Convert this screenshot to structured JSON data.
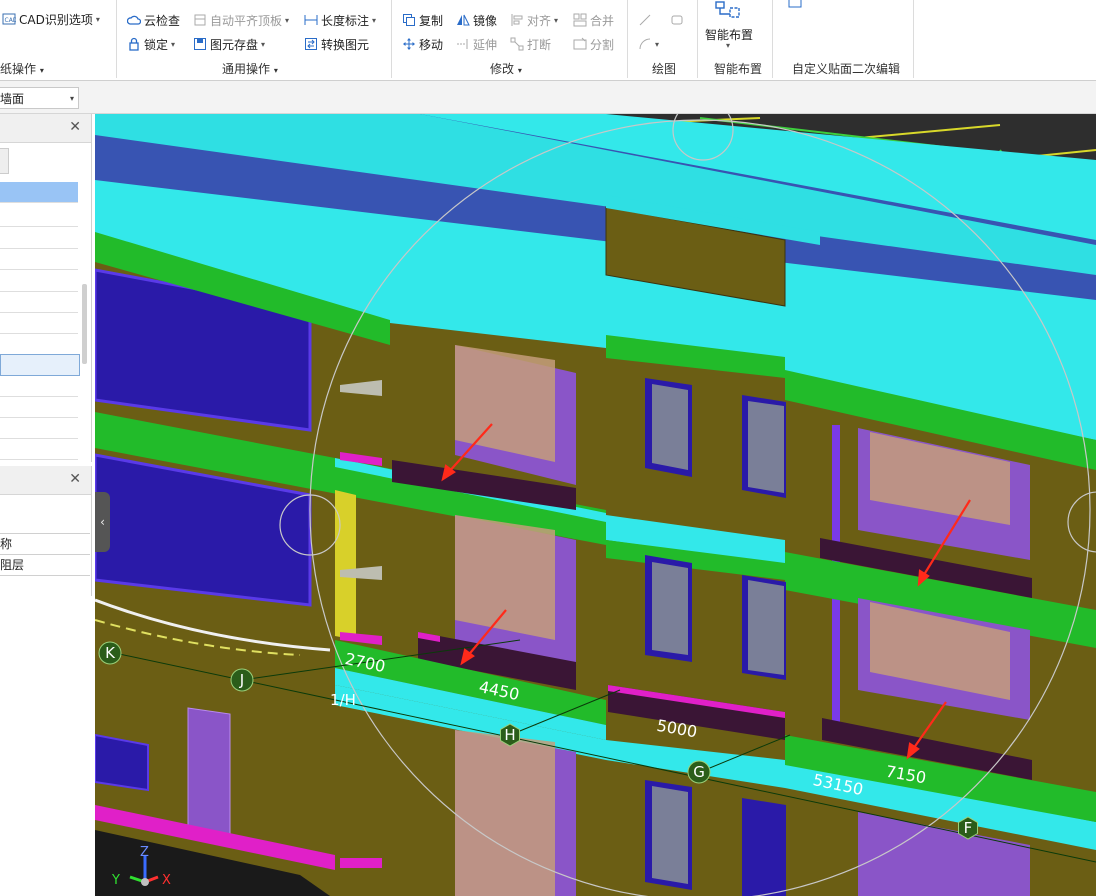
{
  "ribbon": {
    "left_group": {
      "cad_option": "CAD识别选项",
      "label": "纸操作"
    },
    "common_ops": {
      "cloud_check": "云检查",
      "auto_level_slab": "自动平齐顶板",
      "length_dimension": "长度标注",
      "lock": "锁定",
      "element_save": "图元存盘",
      "convert_element": "转换图元",
      "label": "通用操作"
    },
    "modify": {
      "copy": "复制",
      "mirror": "镜像",
      "align": "对齐",
      "merge": "合并",
      "move": "移动",
      "extend": "延伸",
      "break": "打断",
      "split": "分割",
      "label": "修改"
    },
    "draw": {
      "label": "绘图"
    },
    "smart_layout": {
      "button": "智能布置",
      "label": "智能布置"
    },
    "custom_edit": {
      "label": "自定义贴面二次编辑"
    }
  },
  "toolbar": {
    "floor_select": "墙面"
  },
  "left_panel_2": {
    "rows": [
      "称",
      "阻层"
    ]
  },
  "viewport": {
    "axis_labels": [
      "K",
      "J",
      "1/H",
      "H",
      "G",
      "F"
    ],
    "dimensions": [
      "2700",
      "4450",
      "5000",
      "7150",
      "53150"
    ],
    "view_axes": {
      "x": "X",
      "y": "Y",
      "z": "Z"
    }
  },
  "colors": {
    "slab": "#22bb2a",
    "beam": "#33e8ea",
    "wall": "#6b5e14",
    "window": "#2a1aa8",
    "glass": "#8a55c8",
    "annotation_arrow": "#ff2a1a"
  }
}
